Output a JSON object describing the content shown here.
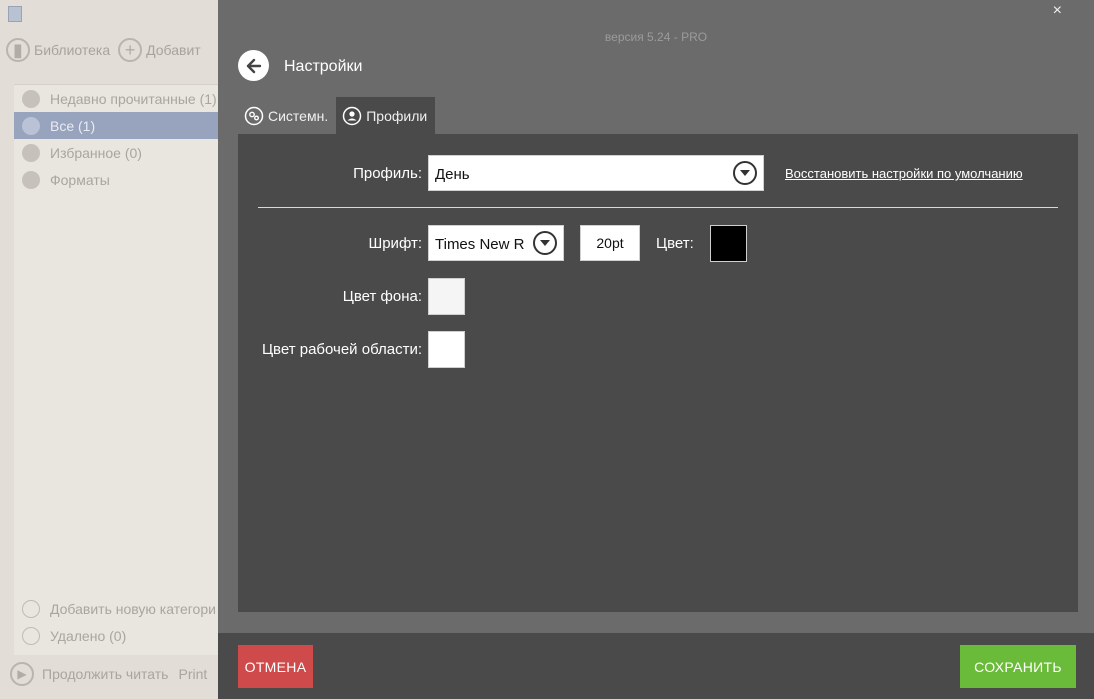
{
  "library": {
    "toolbar": {
      "library_label": "Библиотека",
      "add_label": "Добавит"
    },
    "categories": [
      {
        "label": "Недавно прочитанные (1)",
        "icon": "share-icon"
      },
      {
        "label": "Все (1)",
        "icon": "book-icon",
        "active": true
      },
      {
        "label": "Избранное (0)",
        "icon": "star-icon"
      },
      {
        "label": "Форматы",
        "icon": "file-icon"
      }
    ],
    "bottom_items": [
      {
        "label": "Добавить новую категори",
        "icon": "plus-icon"
      },
      {
        "label": "Удалено (0)",
        "icon": "trash-icon"
      }
    ],
    "footer": {
      "continue_label": "Продолжить читать",
      "print_label": "Print"
    }
  },
  "settings": {
    "version": "версия 5.24 - PRO",
    "close_label": "×",
    "title": "Настройки",
    "tabs": [
      {
        "label": "Системн.",
        "icon": "gears-icon",
        "active": false
      },
      {
        "label": "Профили",
        "icon": "user-icon",
        "active": true
      }
    ],
    "profile": {
      "label": "Профиль:",
      "selected": "День",
      "restore_link": "Восстановить настройки по умолчанию"
    },
    "font": {
      "label": "Шрифт:",
      "selected": "Times New Roman",
      "size": "20pt",
      "color_label": "Цвет:",
      "color": "#000000"
    },
    "background": {
      "label": "Цвет фона:",
      "color": "#f5f5f5"
    },
    "workspace": {
      "label": "Цвет рабочей области:",
      "color": "#ffffff"
    },
    "buttons": {
      "cancel": "ОТМЕНА",
      "save": "СОХРАНИТЬ"
    }
  },
  "colors": {
    "cancel": "#cf4a4a",
    "save": "#6bbb3a",
    "panel": "#4a4a4a",
    "overlay": "#6b6b6b"
  }
}
